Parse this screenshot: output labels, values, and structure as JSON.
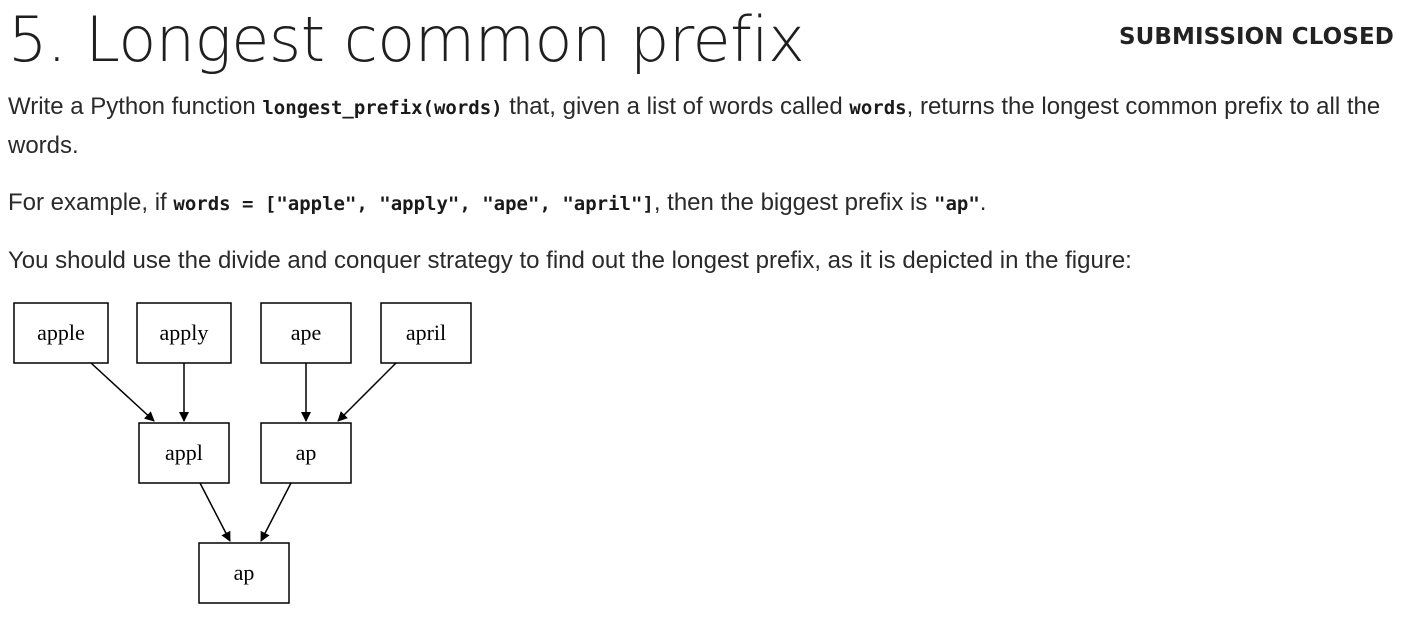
{
  "header": {
    "title": "5. Longest common prefix",
    "status": "SUBMISSION CLOSED"
  },
  "description": {
    "p1_before": "Write a Python function ",
    "p1_code1": "longest_prefix(words)",
    "p1_middle": " that, given a list of words called ",
    "p1_code2": "words",
    "p1_after": ", returns the longest common prefix to all the words.",
    "p2_before": "For example, if ",
    "p2_code1": "words = [\"apple\", \"apply\", \"ape\", \"april\"]",
    "p2_middle": ", then the biggest prefix is ",
    "p2_code2": "\"ap\"",
    "p2_after": ".",
    "p3": "You should use the divide and conquer strategy to find out the longest prefix, as it is depicted in the figure:"
  },
  "diagram": {
    "level0": [
      "apple",
      "apply",
      "ape",
      "april"
    ],
    "level1": [
      "appl",
      "ap"
    ],
    "level2": [
      "ap"
    ],
    "edges": [
      [
        "apple",
        "appl"
      ],
      [
        "apply",
        "appl"
      ],
      [
        "ape",
        "ap"
      ],
      [
        "april",
        "ap"
      ],
      [
        "appl",
        "ap-final"
      ],
      [
        "ap",
        "ap-final"
      ]
    ]
  }
}
